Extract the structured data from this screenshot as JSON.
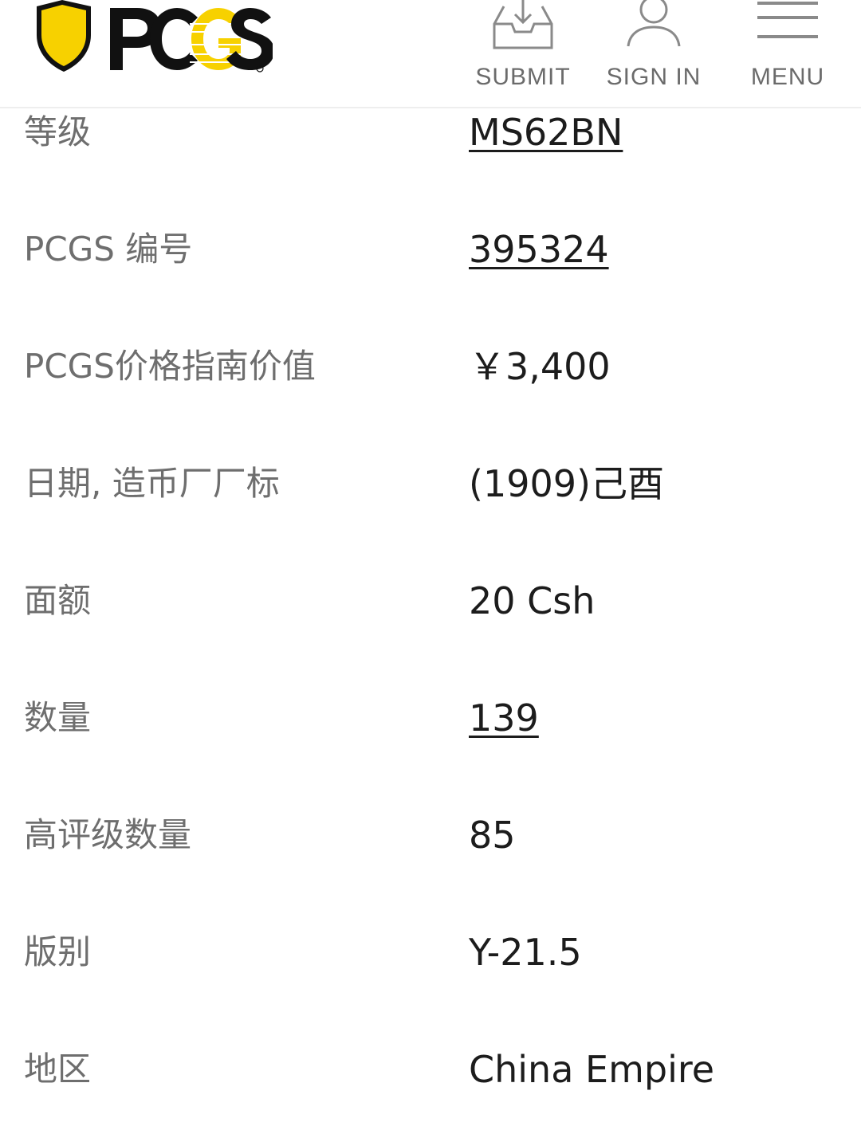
{
  "header": {
    "logo_text": "PCGS",
    "nav": [
      {
        "label": "SUBMIT",
        "icon": "inbox-download-icon"
      },
      {
        "label": "SIGN IN",
        "icon": "user-icon"
      },
      {
        "label": "MENU",
        "icon": "hamburger-menu-icon"
      }
    ]
  },
  "details": [
    {
      "label": "等级",
      "value": "MS62BN",
      "link": true
    },
    {
      "label": "PCGS 编号",
      "value": "395324",
      "link": true
    },
    {
      "label": "PCGS价格指南价值",
      "value": "￥3,400",
      "link": false
    },
    {
      "label": "日期, 造币厂厂标",
      "value": "(1909)己酉",
      "link": false
    },
    {
      "label": "面额",
      "value": "20 Csh",
      "link": false
    },
    {
      "label": "数量",
      "value": "139",
      "link": true
    },
    {
      "label": "高评级数量",
      "value": "85",
      "link": false
    },
    {
      "label": "版别",
      "value": "Y-21.5",
      "link": false
    },
    {
      "label": "地区",
      "value": "China Empire",
      "link": false
    }
  ],
  "colors": {
    "brand_yellow": "#F7D100",
    "brand_black": "#111111",
    "label_gray": "#6E6E6E",
    "value_dark": "#1C1C1C",
    "nav_gray": "#6B6B6B"
  }
}
